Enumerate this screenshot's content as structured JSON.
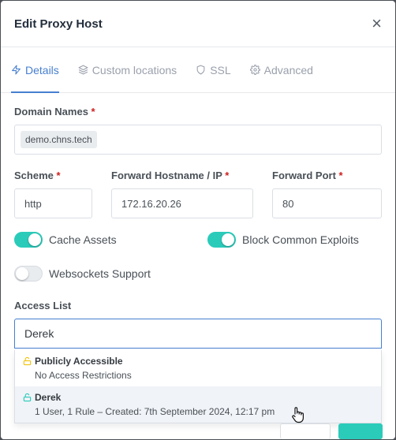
{
  "modal": {
    "title": "Edit Proxy Host",
    "close_label": "×"
  },
  "tabs": [
    {
      "label": "Details",
      "icon": "bolt-icon",
      "active": true
    },
    {
      "label": "Custom locations",
      "icon": "layers-icon",
      "active": false
    },
    {
      "label": "SSL",
      "icon": "shield-icon",
      "active": false
    },
    {
      "label": "Advanced",
      "icon": "gear-icon",
      "active": false
    }
  ],
  "domain": {
    "label": "Domain Names",
    "required": "*",
    "tags": [
      "demo.chns.tech"
    ]
  },
  "scheme": {
    "label": "Scheme",
    "required": "*",
    "value": "http"
  },
  "hostname": {
    "label": "Forward Hostname / IP",
    "required": "*",
    "value": "172.16.20.26"
  },
  "port": {
    "label": "Forward Port",
    "required": "*",
    "value": "80"
  },
  "toggles": {
    "cache_assets": {
      "label": "Cache Assets",
      "on": true
    },
    "block_exploits": {
      "label": "Block Common Exploits",
      "on": true
    },
    "websockets": {
      "label": "Websockets Support",
      "on": false
    }
  },
  "access_list": {
    "label": "Access List",
    "value": "Derek",
    "options": [
      {
        "title": "Publicly Accessible",
        "subtitle": "No Access Restrictions",
        "icon_color": "#f1c40f"
      },
      {
        "title": "Derek",
        "subtitle": "1 User, 1 Rule – Created: 7th September 2024, 12:17 pm",
        "icon_color": "#2bcbba"
      }
    ]
  },
  "colors": {
    "accent": "#467fcf",
    "toggle_on": "#2bcbba",
    "required": "#cd201f"
  }
}
